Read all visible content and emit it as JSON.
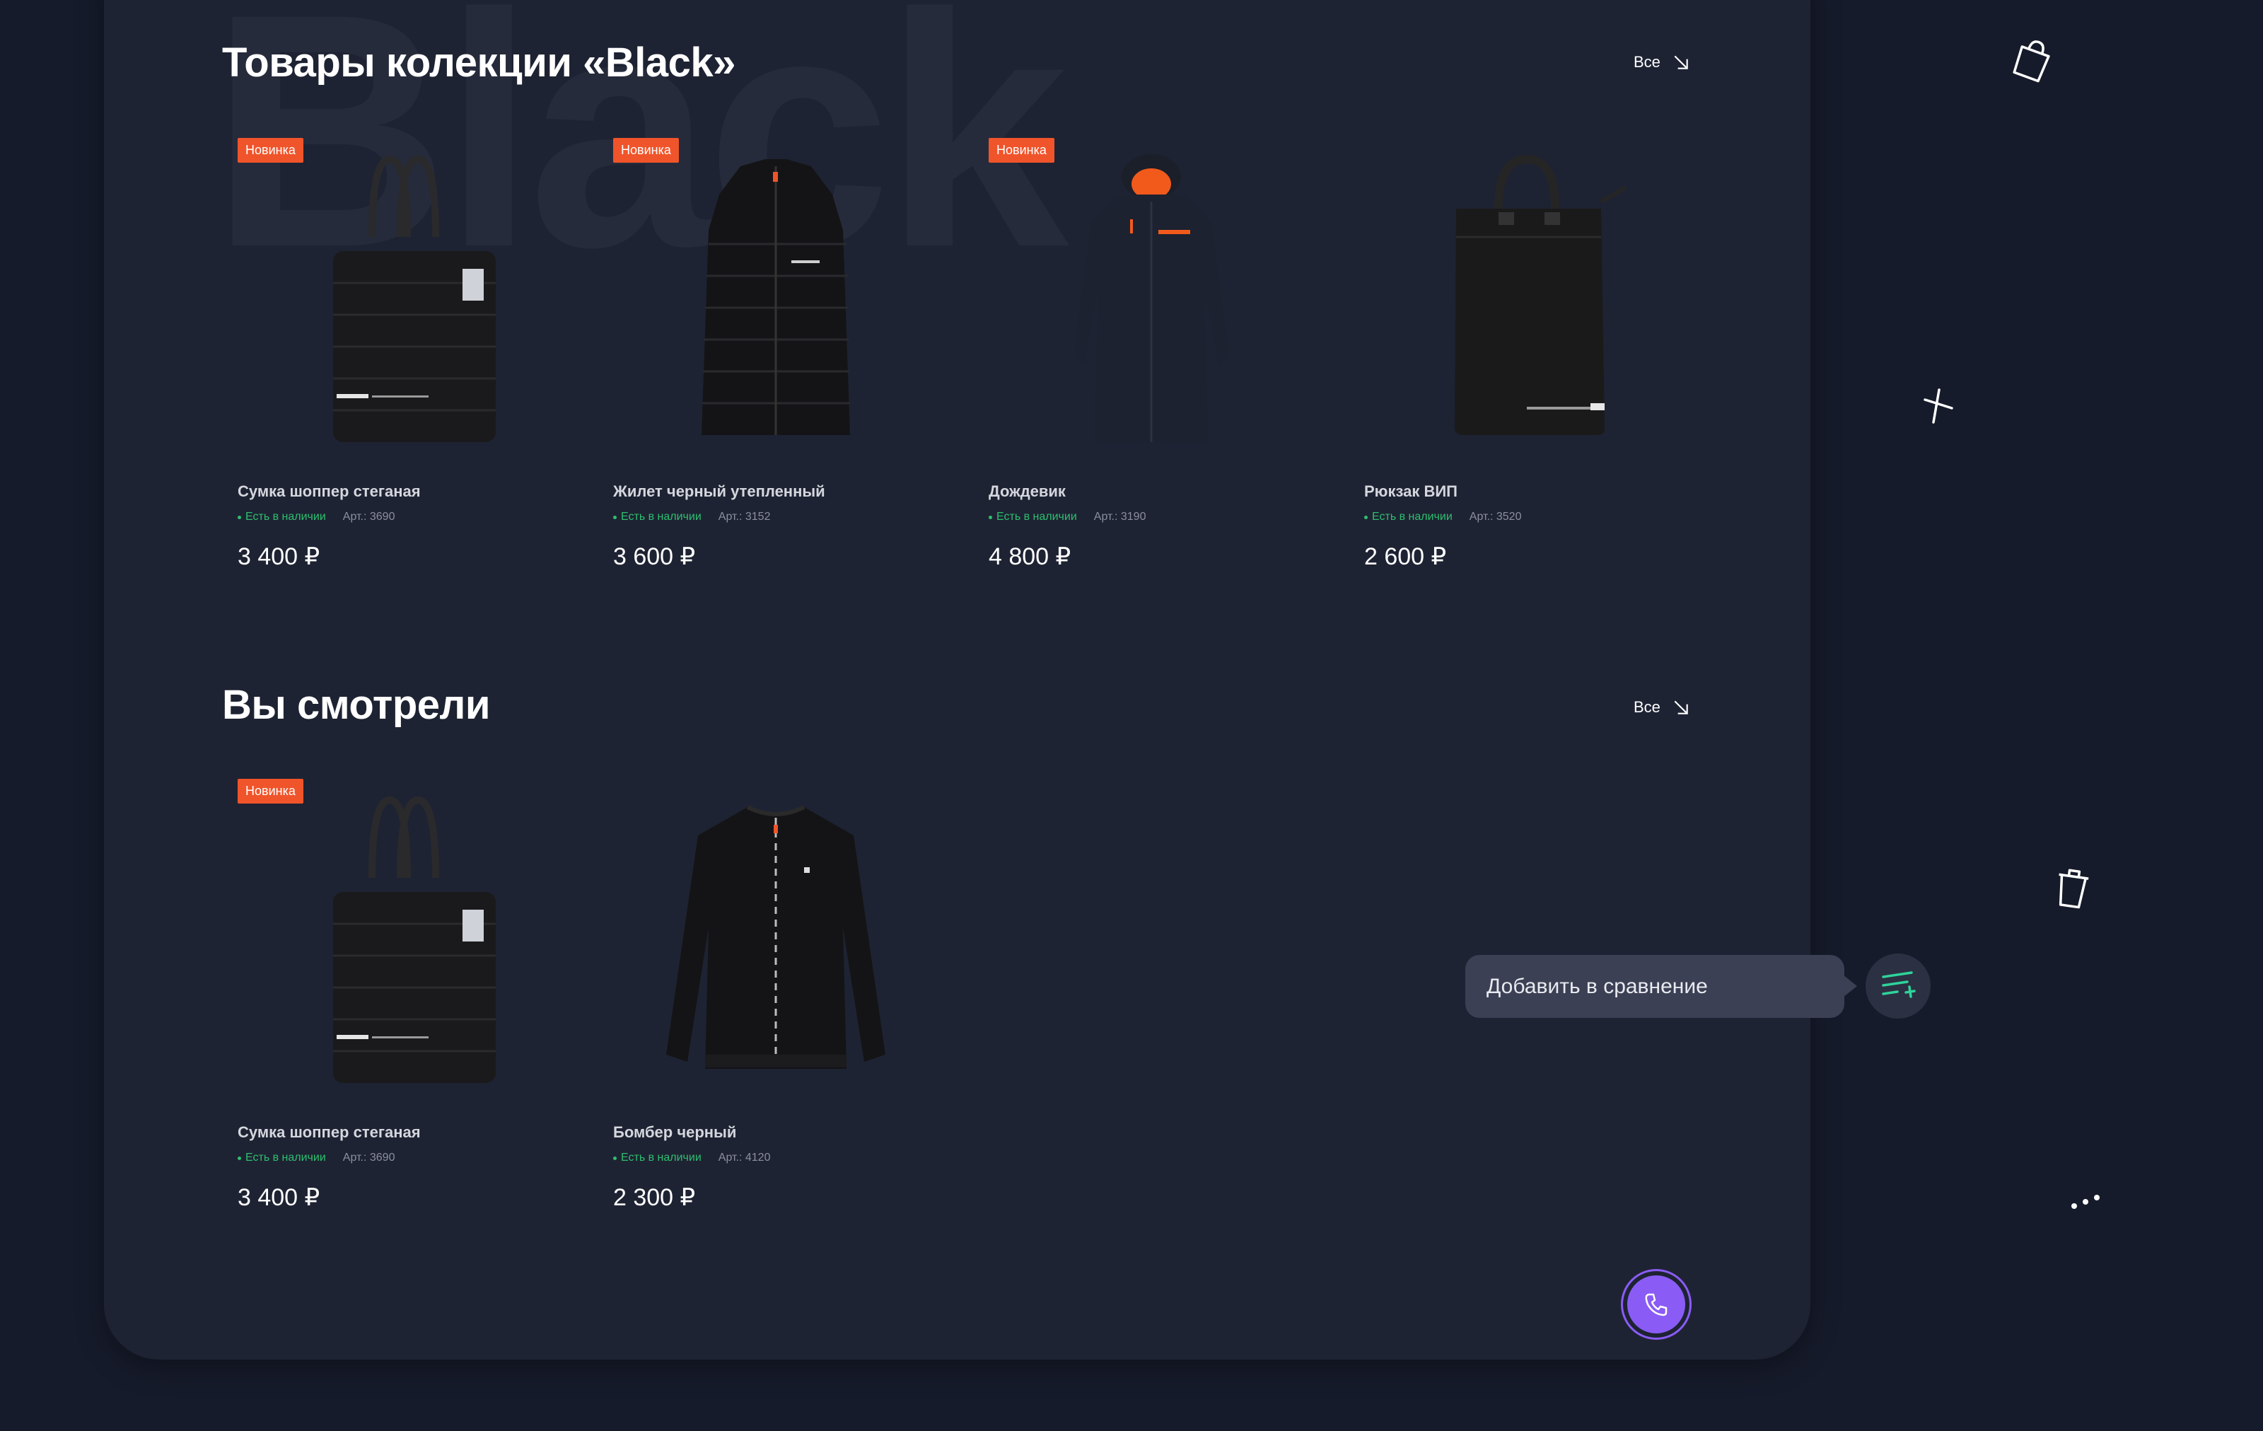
{
  "watermark": "Black",
  "collection": {
    "title": "Товары колекции «Black»",
    "all_label": "Все",
    "items": [
      {
        "badge": "Новинка",
        "name": "Сумка шоппер стеганая",
        "stock": "Есть в наличии",
        "art": "Арт.: 3690",
        "price": "3 400 ₽",
        "image": "tote-bag"
      },
      {
        "badge": "Новинка",
        "name": "Жилет черный утепленный",
        "stock": "Есть в наличии",
        "art": "Арт.: 3152",
        "price": "3 600 ₽",
        "image": "vest"
      },
      {
        "badge": "Новинка",
        "name": "Дождевик",
        "stock": "Есть в наличии",
        "art": "Арт.: 3190",
        "price": "4 800 ₽",
        "image": "raincoat"
      },
      {
        "badge": "",
        "name": "Рюкзак ВИП",
        "stock": "Есть в наличии",
        "art": "Арт.: 3520",
        "price": "2 600 ₽",
        "image": "backpack"
      }
    ]
  },
  "viewed": {
    "title": "Вы смотрели",
    "all_label": "Все",
    "items": [
      {
        "badge": "Новинка",
        "name": "Сумка шоппер стеганая",
        "stock": "Есть в наличии",
        "art": "Арт.: 3690",
        "price": "3 400 ₽",
        "image": "tote-bag"
      },
      {
        "badge": "",
        "name": "Бомбер черный",
        "stock": "Есть в наличии",
        "art": "Арт.: 4120",
        "price": "2 300 ₽",
        "image": "bomber"
      }
    ]
  },
  "compare_tooltip": "Добавить в сравнение",
  "icons": {
    "cart": "shopping-bag-icon",
    "close": "close-icon",
    "trash": "trash-icon",
    "more": "more-dots-icon",
    "compare": "compare-add-icon",
    "call": "phone-icon"
  },
  "colors": {
    "background": "#161b2b",
    "panel": "#1e2333",
    "badge": "#f0542a",
    "in_stock": "#2dbf6e",
    "accent": "#8a5cf5",
    "compare_icon": "#2fd39b"
  }
}
